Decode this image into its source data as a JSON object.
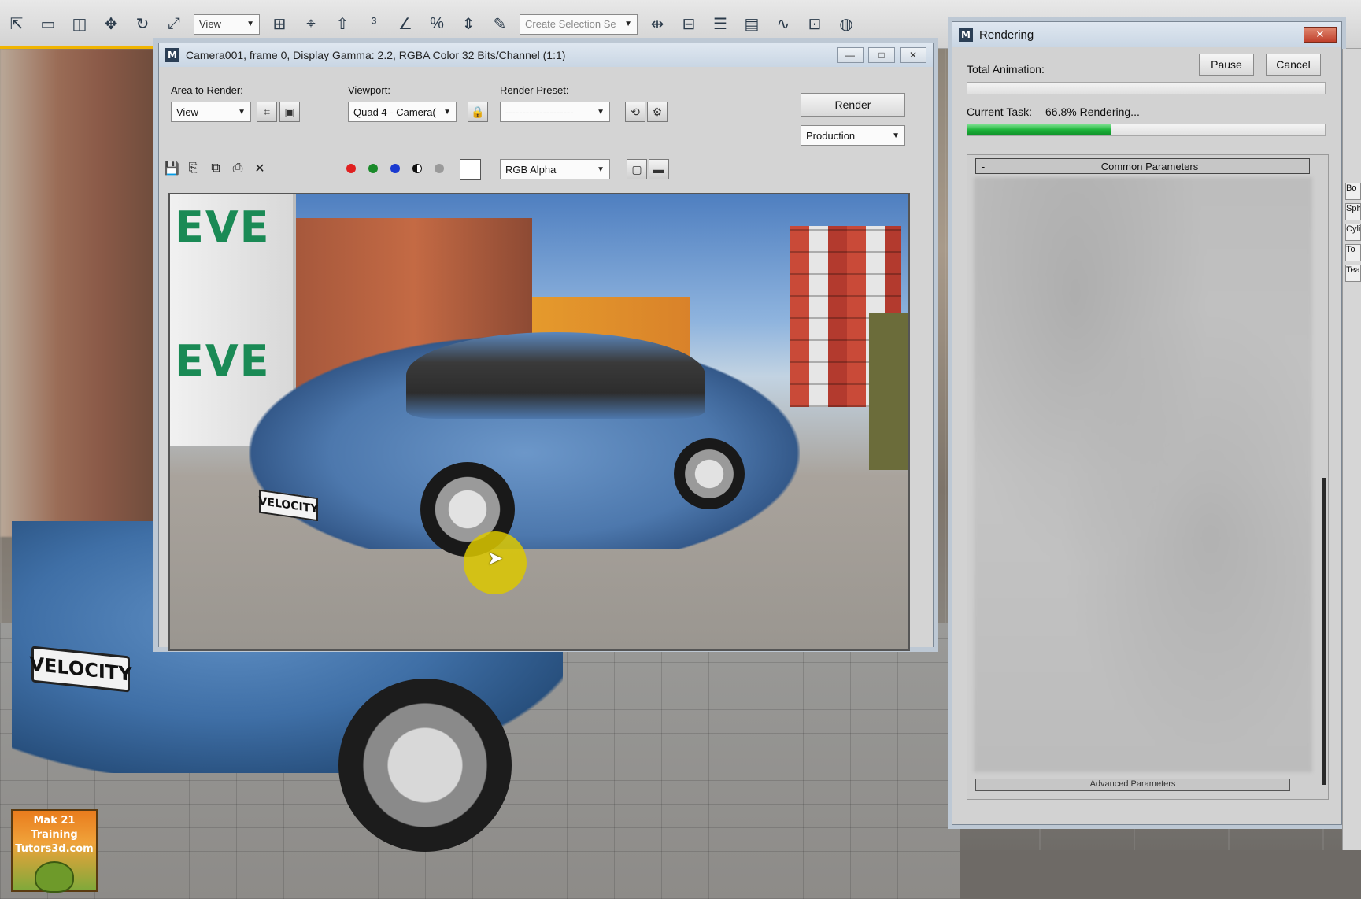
{
  "main_toolbar": {
    "ref_coord_select": "View",
    "selection_set_select": "Create Selection Se"
  },
  "frame_buffer": {
    "title": "Camera001, frame 0, Display Gamma: 2.2, RGBA Color 32 Bits/Channel (1:1)",
    "area_to_render_label": "Area to Render:",
    "area_to_render_value": "View",
    "viewport_label": "Viewport:",
    "viewport_value": "Quad 4 - Camera(",
    "render_preset_label": "Render Preset:",
    "render_preset_value": "--------------------",
    "render_button": "Render",
    "production_value": "Production",
    "channel_value": "RGB Alpha",
    "render_image": {
      "container_text_top": "EVE",
      "container_text_bottom": "EVE",
      "plate_text": "VELOCITY"
    }
  },
  "viewport_bg": {
    "plate_text": "VELOCITY"
  },
  "logo": {
    "line1": "Mak 21 Training",
    "line2": "Tutors3d.com"
  },
  "rendering_dialog": {
    "title": "Rendering",
    "total_animation_label": "Total Animation:",
    "pause_button": "Pause",
    "cancel_button": "Cancel",
    "current_task_label": "Current Task:",
    "current_task_status": "66.8%  Rendering...",
    "current_task_progress": 0.668,
    "total_animation_progress": 0.0,
    "rollout_common": "Common Parameters",
    "rollout_advanced": "Advanced Parameters",
    "rollout_collapse_glyph": "-"
  },
  "cmd_panel": {
    "items": [
      "Bo",
      "Sph",
      "Cyli",
      "To",
      "Tea"
    ]
  },
  "colors": {
    "progress_green": "#1db43a",
    "titlebar_blue": "#c9d6e4",
    "close_red": "#c0402c"
  }
}
